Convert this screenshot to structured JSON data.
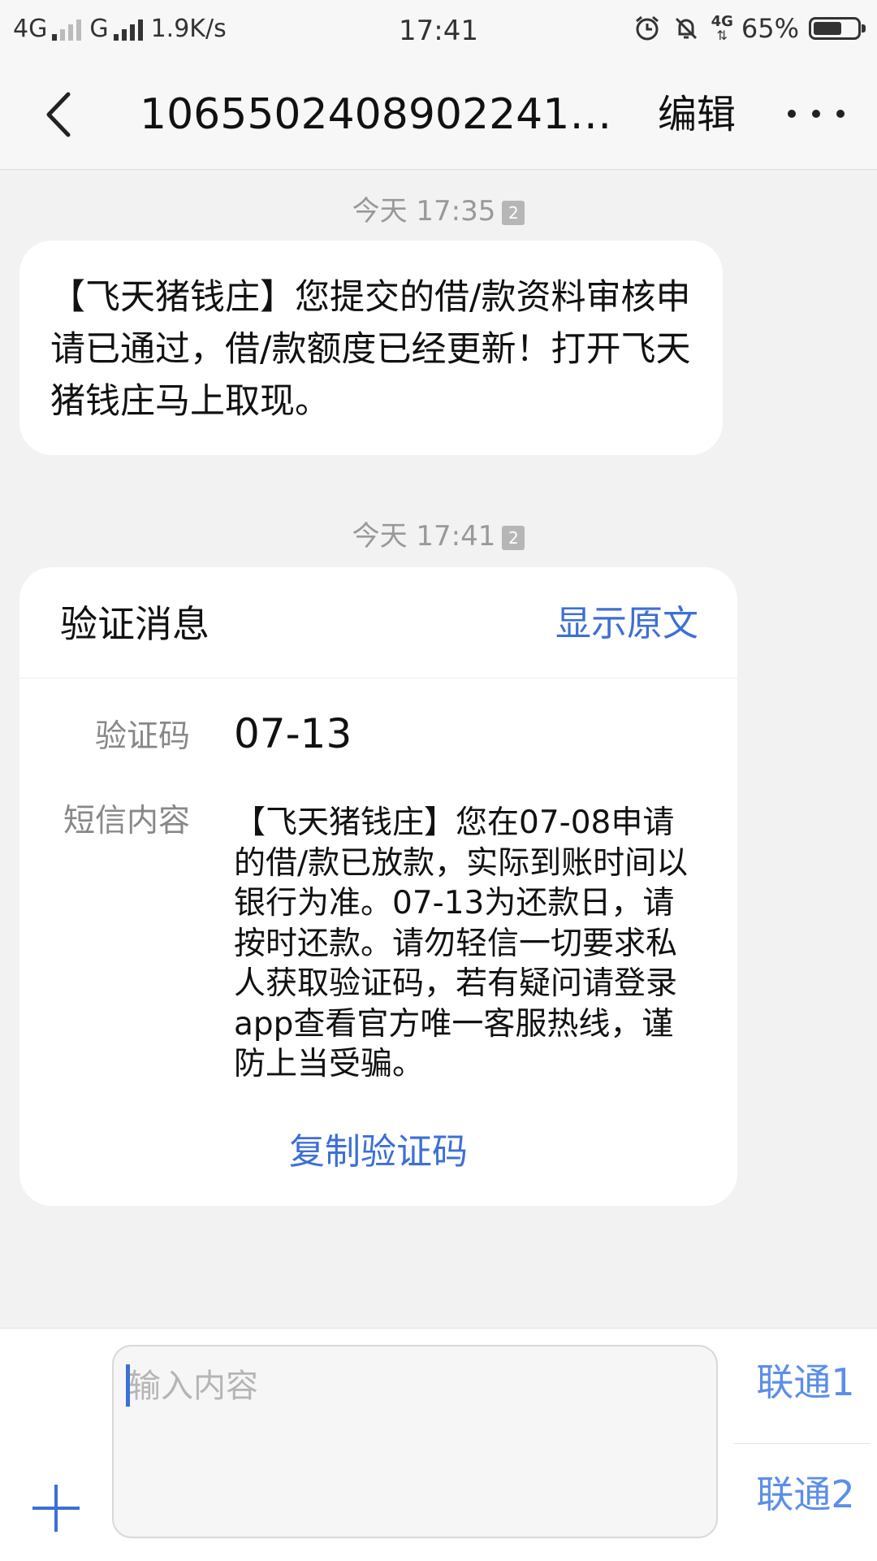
{
  "status_bar": {
    "network1": "4G",
    "network2": "G",
    "speed": "1.9K/s",
    "time": "17:41",
    "network_badge": "4G",
    "battery": "65%",
    "battery_level": 0.65
  },
  "header": {
    "title": "106550240890224148…",
    "edit_label": "编辑"
  },
  "messages": [
    {
      "timestamp": "今天 17:35",
      "sim": "2",
      "text": "【飞天猪钱庄】您提交的借/款资料审核申请已通过，借/款额度已经更新！打开飞天猪钱庄马上取现。"
    },
    {
      "timestamp": "今天 17:41",
      "sim": "2"
    }
  ],
  "verification_card": {
    "title": "验证消息",
    "show_original_label": "显示原文",
    "code_label": "验证码",
    "code_value": "07-13",
    "content_label": "短信内容",
    "content": "【飞天猪钱庄】您在07-08申请的借/款已放款，实际到账时间以银行为准。07-13为还款日，请按时还款。请勿轻信一切要求私人获取验证码，若有疑问请登录app查看官方唯一客服热线，谨防上当受骗。",
    "copy_label": "复制验证码"
  },
  "input_bar": {
    "placeholder": "输入内容",
    "value": "",
    "sim1_label": "联通1",
    "sim2_label": "联通2"
  },
  "colors": {
    "accent": "#3d6fd6",
    "sim_accent": "#5b8ee8",
    "background": "#f2f2f2",
    "timestamp": "#999999"
  }
}
